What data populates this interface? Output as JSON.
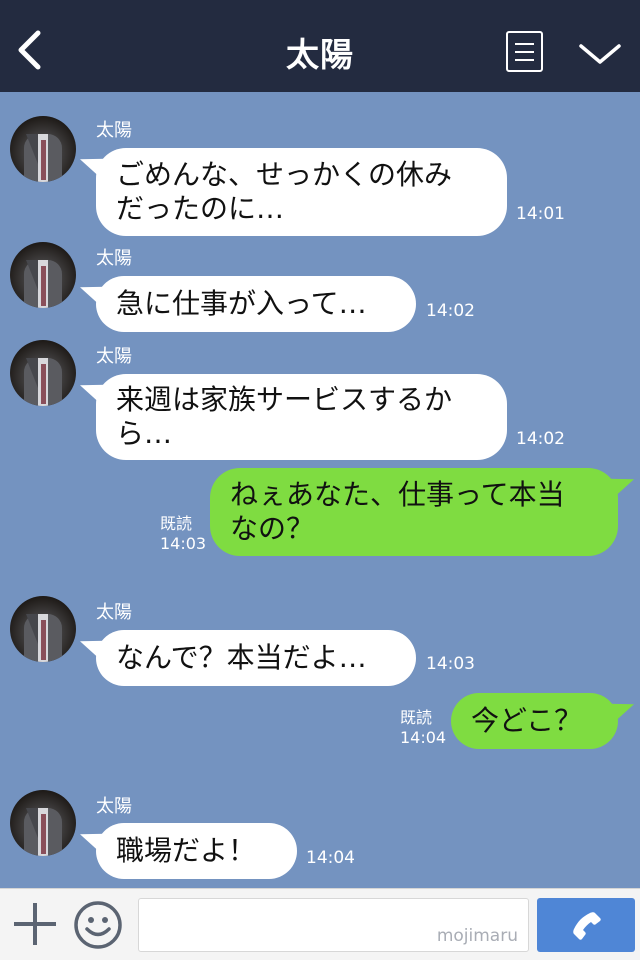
{
  "header": {
    "title": "太陽"
  },
  "messages": [
    {
      "sender": "太陽",
      "lines": [
        "ごめんな、せっかくの休み",
        "だったのに…"
      ],
      "time": "14:01"
    },
    {
      "sender": "太陽",
      "lines": [
        "急に仕事が入って…"
      ],
      "time": "14:02"
    },
    {
      "sender": "太陽",
      "lines": [
        "来週は家族サービスするか",
        "ら…"
      ],
      "time": "14:02"
    },
    {
      "sender": "me",
      "lines": [
        "ねぇあなた、仕事って本当",
        "なの？"
      ],
      "read": "既読",
      "time": "14:03"
    },
    {
      "sender": "太陽",
      "lines": [
        "なんで？本当だよ…"
      ],
      "time": "14:03"
    },
    {
      "sender": "me",
      "lines": [
        "今どこ？"
      ],
      "read": "既読",
      "time": "14:04"
    },
    {
      "sender": "太陽",
      "lines": [
        "職場だよ！"
      ],
      "time": "14:04"
    }
  ],
  "input": {
    "watermark": "mojimaru"
  },
  "colors": {
    "header_bg": "#232b40",
    "chat_bg": "#7493c0",
    "outgoing_bubble": "#7fdc41",
    "send_button": "#4f86d6"
  },
  "icons": {
    "back": "chevron-left-icon",
    "menu": "menu-icon",
    "collapse": "chevron-down-icon",
    "add": "plus-icon",
    "emoji": "smiley-icon",
    "send": "phone-icon"
  }
}
